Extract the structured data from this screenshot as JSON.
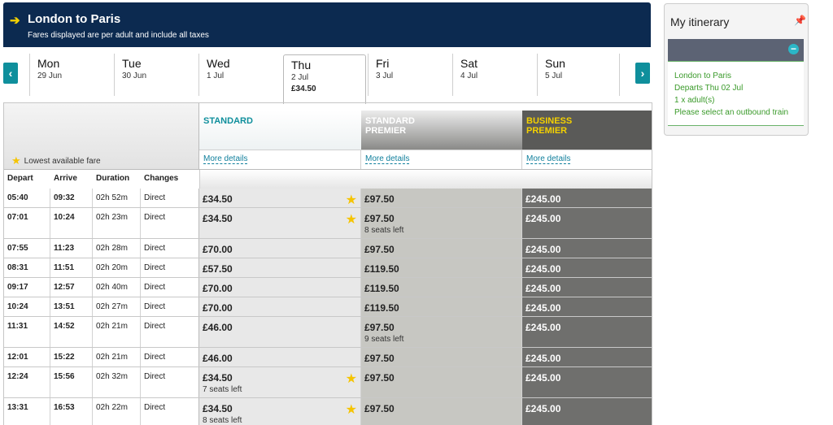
{
  "header": {
    "title": "London to Paris",
    "subtitle": "Fares displayed are per adult and include all taxes"
  },
  "days": [
    {
      "name": "Mon",
      "date": "29 Jun"
    },
    {
      "name": "Tue",
      "date": "30 Jun"
    },
    {
      "name": "Wed",
      "date": "1 Jul"
    },
    {
      "name": "Thu",
      "date": "2 Jul",
      "price": "£34.50"
    },
    {
      "name": "Fri",
      "date": "3 Jul"
    },
    {
      "name": "Sat",
      "date": "4 Jul"
    },
    {
      "name": "Sun",
      "date": "5 Jul"
    }
  ],
  "legend": "Lowest available fare",
  "classes": {
    "standard": "STANDARD",
    "standard_premier_1": "STANDARD",
    "standard_premier_2": "PREMIER",
    "business_premier_1": "BUSINESS",
    "business_premier_2": "PREMIER",
    "more_details": "More details"
  },
  "columns": {
    "depart": "Depart",
    "arrive": "Arrive",
    "duration": "Duration",
    "changes": "Changes"
  },
  "trains": [
    {
      "depart": "05:40",
      "arrive": "09:32",
      "duration": "02h 52m",
      "changes": "Direct",
      "std": "£34.50",
      "std_star": true,
      "sp": "£97.50",
      "bp": "£245.00"
    },
    {
      "depart": "07:01",
      "arrive": "10:24",
      "duration": "02h 23m",
      "changes": "Direct",
      "std": "£34.50",
      "std_star": true,
      "sp": "£97.50",
      "sp_seats": "8 seats left",
      "bp": "£245.00"
    },
    {
      "depart": "07:55",
      "arrive": "11:23",
      "duration": "02h 28m",
      "changes": "Direct",
      "std": "£70.00",
      "sp": "£97.50",
      "bp": "£245.00"
    },
    {
      "depart": "08:31",
      "arrive": "11:51",
      "duration": "02h 20m",
      "changes": "Direct",
      "std": "£57.50",
      "sp": "£119.50",
      "bp": "£245.00"
    },
    {
      "depart": "09:17",
      "arrive": "12:57",
      "duration": "02h 40m",
      "changes": "Direct",
      "std": "£70.00",
      "sp": "£119.50",
      "bp": "£245.00"
    },
    {
      "depart": "10:24",
      "arrive": "13:51",
      "duration": "02h 27m",
      "changes": "Direct",
      "std": "£70.00",
      "sp": "£119.50",
      "bp": "£245.00"
    },
    {
      "depart": "11:31",
      "arrive": "14:52",
      "duration": "02h 21m",
      "changes": "Direct",
      "std": "£46.00",
      "sp": "£97.50",
      "sp_seats": "9 seats left",
      "bp": "£245.00"
    },
    {
      "depart": "12:01",
      "arrive": "15:22",
      "duration": "02h 21m",
      "changes": "Direct",
      "std": "£46.00",
      "sp": "£97.50",
      "bp": "£245.00"
    },
    {
      "depart": "12:24",
      "arrive": "15:56",
      "duration": "02h 32m",
      "changes": "Direct",
      "std": "£34.50",
      "std_seats": "7 seats left",
      "std_star": true,
      "sp": "£97.50",
      "bp": "£245.00"
    },
    {
      "depart": "13:31",
      "arrive": "16:53",
      "duration": "02h 22m",
      "changes": "Direct",
      "std": "£34.50",
      "std_seats": "8 seats left",
      "std_star": true,
      "sp": "£97.50",
      "bp": "£245.00"
    }
  ],
  "itinerary": {
    "title": "My itinerary",
    "route": "London to Paris",
    "departs": "Departs Thu 02 Jul",
    "passengers": "1 x adult(s)",
    "note": "Please select an outbound train"
  },
  "colors": {
    "header": "#0c2a50",
    "accent": "#0f8f9c",
    "star": "#f5c400",
    "business": "#f4d100"
  }
}
